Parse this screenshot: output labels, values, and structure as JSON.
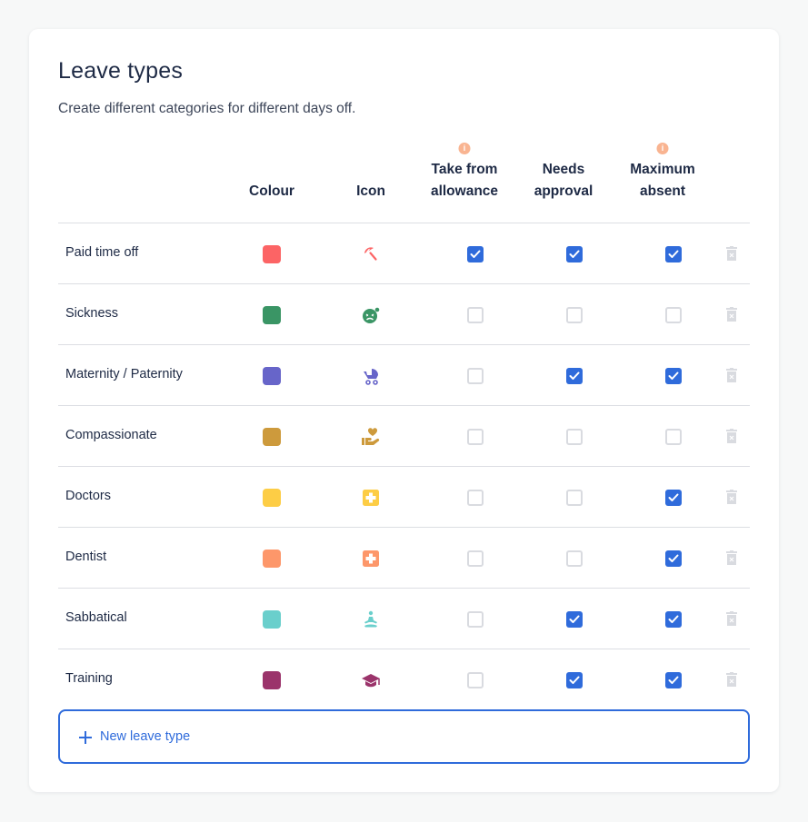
{
  "page": {
    "title": "Leave types",
    "subtitle": "Create different categories for different days off."
  },
  "columns": {
    "colour": "Colour",
    "icon": "Icon",
    "take_from_allowance": [
      "Take from",
      "allowance"
    ],
    "needs_approval": [
      "Needs",
      "approval"
    ],
    "maximum_absent": [
      "Maximum",
      "absent"
    ],
    "info_icon_glyph": "i"
  },
  "colors": {
    "accent": "#2f6bdb",
    "info": "#f9b491",
    "trash": "#d9dbe0"
  },
  "leave_types": [
    {
      "name": "Paid time off",
      "colour": "#fc6465",
      "icon": "umbrella-beach-icon",
      "take_from_allowance": true,
      "needs_approval": true,
      "maximum_absent": true
    },
    {
      "name": "Sickness",
      "colour": "#3a9565",
      "icon": "sick-face-icon",
      "take_from_allowance": false,
      "needs_approval": false,
      "maximum_absent": false
    },
    {
      "name": "Maternity / Paternity",
      "colour": "#6765c9",
      "icon": "baby-carriage-icon",
      "take_from_allowance": false,
      "needs_approval": true,
      "maximum_absent": true
    },
    {
      "name": "Compassionate",
      "colour": "#cd9a3c",
      "icon": "hand-holding-heart-icon",
      "take_from_allowance": false,
      "needs_approval": false,
      "maximum_absent": false
    },
    {
      "name": "Doctors",
      "colour": "#fdcd45",
      "icon": "medical-plus-icon",
      "take_from_allowance": false,
      "needs_approval": false,
      "maximum_absent": true
    },
    {
      "name": "Dentist",
      "colour": "#fd976a",
      "icon": "medical-plus-icon",
      "take_from_allowance": false,
      "needs_approval": false,
      "maximum_absent": true
    },
    {
      "name": "Sabbatical",
      "colour": "#6acfcc",
      "icon": "meditation-icon",
      "take_from_allowance": false,
      "needs_approval": true,
      "maximum_absent": true
    },
    {
      "name": "Training",
      "colour": "#9b346b",
      "icon": "graduation-cap-icon",
      "take_from_allowance": false,
      "needs_approval": true,
      "maximum_absent": true
    }
  ],
  "new_button": {
    "label": "New leave type",
    "icon": "plus-icon"
  }
}
